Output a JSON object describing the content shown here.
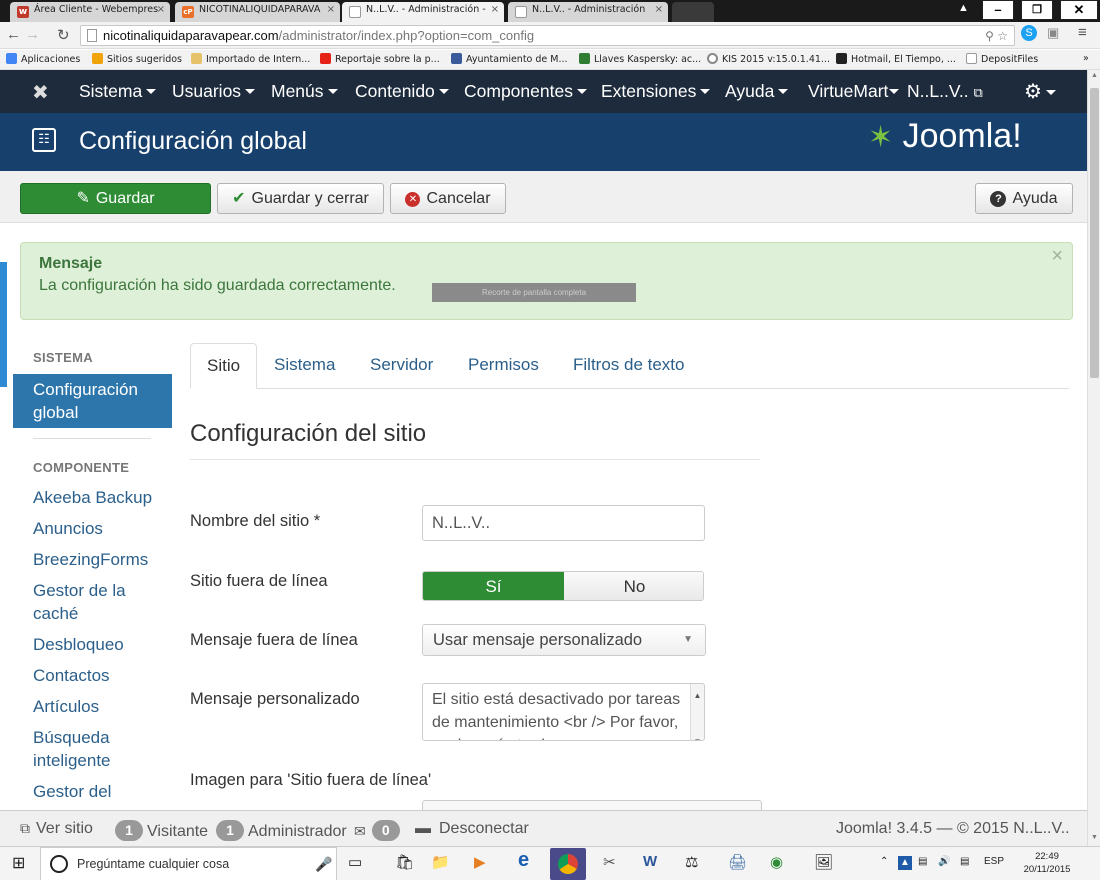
{
  "browser": {
    "tabs": [
      {
        "title": "Área Cliente - Webempres",
        "favicon": "W",
        "favcolor": "#c0392b"
      },
      {
        "title": "NICOTINALIQUIDAPARAVA",
        "favicon": "cP",
        "favcolor": "#e8702a"
      },
      {
        "title": "N..L.V.. - Administración -",
        "favicon": "doc",
        "favcolor": "#999"
      },
      {
        "title": "N..L.V.. - Administración",
        "favicon": "doc",
        "favcolor": "#999"
      }
    ],
    "url_host": "nicotinaliquidaparavapear.com",
    "url_path": "/administrator/index.php?option=com_config",
    "bookmarks": [
      {
        "label": "Aplicaciones",
        "color": "#4285f4"
      },
      {
        "label": "Sitios sugeridos",
        "color": "#f0a30a"
      },
      {
        "label": "Importado de Intern...",
        "color": "#e6c36a"
      },
      {
        "label": "Reportaje sobre la p...",
        "color": "#e62117"
      },
      {
        "label": "Ayuntamiento de M...",
        "color": "#3a5a9c"
      },
      {
        "label": "Llaves Kaspersky: ac...",
        "color": "#2e7d32"
      },
      {
        "label": "KIS 2015 v:15.0.1.41...",
        "color": "#888"
      },
      {
        "label": "Hotmail, El Tiempo, ...",
        "color": "#222"
      },
      {
        "label": "DepositFiles",
        "color": "#bbb"
      }
    ],
    "more": "»"
  },
  "joomla_nav": {
    "menus": [
      "Sistema",
      "Usuarios",
      "Menús",
      "Contenido",
      "Componentes",
      "Extensiones",
      "Ayuda",
      "VirtueMart"
    ],
    "site_link": "N..L..V..",
    "settings_icon": "gear-icon"
  },
  "header": {
    "title": "Configuración global",
    "brand": "Joomla!"
  },
  "toolbar": {
    "save": "Guardar",
    "save_close": "Guardar y cerrar",
    "cancel": "Cancelar",
    "help": "Ayuda"
  },
  "message": {
    "title": "Mensaje",
    "text": "La configuración ha sido guardada correctamente.",
    "snip_label": "Recorte de pantalla completa",
    "close": "×"
  },
  "sidebar": {
    "system_heading": "SISTEMA",
    "active_item": "Configuración global",
    "component_heading": "COMPONENTE",
    "components": [
      "Akeeba Backup",
      "Anuncios",
      "BreezingForms",
      "Gestor de la caché",
      "Desbloqueo",
      "Contactos",
      "Artículos",
      "Búsqueda inteligente",
      "Gestor del"
    ]
  },
  "tabs": [
    "Sitio",
    "Sistema",
    "Servidor",
    "Permisos",
    "Filtros de texto"
  ],
  "form": {
    "section_title": "Configuración del sitio",
    "site_name_label": "Nombre del sitio *",
    "site_name_value": "N..L..V..",
    "offline_label": "Sitio fuera de línea",
    "offline_yes": "Sí",
    "offline_no": "No",
    "offline_selected": "Sí",
    "offline_message_label": "Mensaje fuera de línea",
    "offline_message_value": "Usar mensaje personalizado",
    "custom_message_label": "Mensaje personalizado",
    "custom_message_value": "El sitio está desactivado por tareas de mantenimiento <br /> Por favor, vuelva más tarde.",
    "offline_image_label": "Imagen para 'Sitio fuera de línea'"
  },
  "statusbar": {
    "view_site": "Ver sitio",
    "visitors_count": "1",
    "visitors_label": "Visitante",
    "admins_count": "1",
    "admins_label": "Administrador",
    "messages_count": "0",
    "logout": "Desconectar",
    "version": "Joomla! 3.4.5 — © 2015 N..L..V.."
  },
  "taskbar": {
    "search_placeholder": "Pregúntame cualquier cosa",
    "language": "ESP",
    "time": "22:49",
    "date": "20/11/2015"
  }
}
